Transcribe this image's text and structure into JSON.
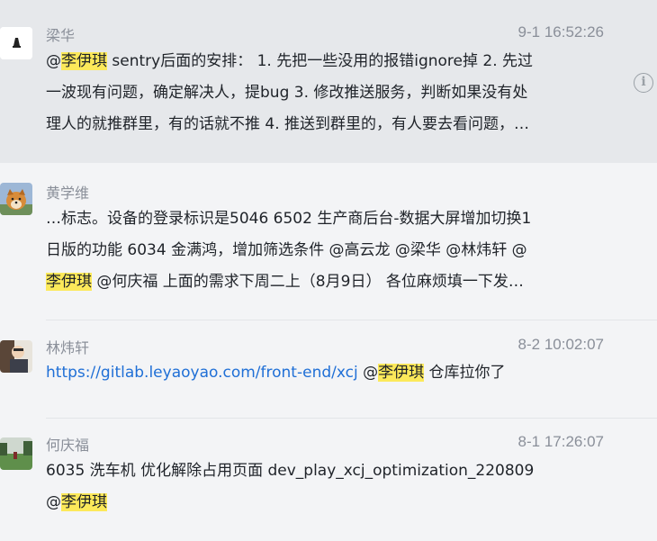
{
  "messages": [
    {
      "sender": "梁华",
      "time": "9-1 16:52:26",
      "avatar_icon": "white-avatar-icon",
      "lines": [
        [
          "@",
          {
            "hl": "李伊琪"
          },
          " sentry后面的安排： 1. 先把一些没用的报错ignore掉 2. 先过"
        ],
        [
          "一波现有问题，确定解决人，提bug 3. 修改推送服务，判断如果没有处"
        ],
        [
          "理人的就推群里，有的话就不推 4. 推送到群里的，有人要去看问题，…"
        ]
      ]
    },
    {
      "sender": "黄学维",
      "time": "",
      "avatar_icon": "dog-avatar-icon",
      "lines": [
        [
          "…标志。设备的登录标识是5046 6502 生产商后台-数据大屏增加切换1"
        ],
        [
          "日版的功能 6034 金满鸿，增加筛选条件 @高云龙 @梁华 @林炜轩 @"
        ],
        [
          {
            "hl": "李伊琪"
          },
          " @何庆福 上面的需求下周二上（8月9日） 各位麻烦填一下发…"
        ]
      ]
    },
    {
      "sender": "林炜轩",
      "time": "8-2 10:02:07",
      "avatar_icon": "photo-avatar-icon",
      "lines": [
        [
          {
            "link": "https://gitlab.leyaoyao.com/front-end/xcj"
          },
          " @",
          {
            "hl": "李伊琪"
          },
          " 仓库拉你了"
        ]
      ]
    },
    {
      "sender": "何庆福",
      "time": "8-1 17:26:07",
      "avatar_icon": "landscape-avatar-icon",
      "lines": [
        [
          "6035 洗车机 优化解除占用页面 dev_play_xcj_optimization_220809"
        ],
        [
          "@",
          {
            "hl": "李伊琪"
          }
        ]
      ]
    }
  ],
  "info_icon": "info-icon",
  "info_glyph": "i"
}
